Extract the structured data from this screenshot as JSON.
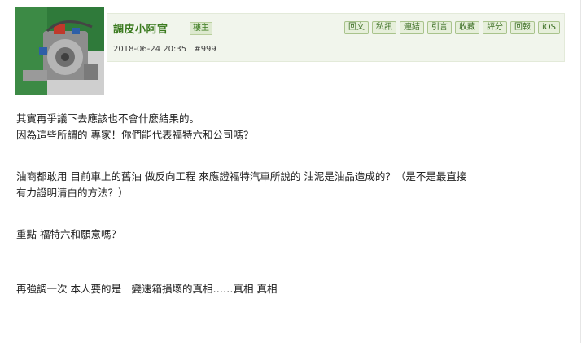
{
  "post": {
    "author": "調皮小阿官",
    "role": "樓主",
    "timestamp": "2018-06-24 20:35",
    "post_number": "#999",
    "actions": [
      "回文",
      "私訊",
      "連結",
      "引言",
      "收藏",
      "評分",
      "回報",
      "iOS"
    ],
    "body": [
      "其實再爭議下去應該也不會什麼結果的。",
      "因為這些所謂的 專家！你們能代表福特六和公司嗎？",
      "油商都敢用 目前車上的舊油 做反向工程 來應證福特汽車所說的 油泥是油品造成的？（是不是最直接",
      "有力證明清白的方法？）",
      "重點 福特六和願意嗎？",
      "再強調一次 本人要的是　變速箱損壞的真相……真相 真相"
    ]
  },
  "colors": {
    "header_bg": "#f1f5ec",
    "author_color": "#3a7a1e",
    "button_bg": "#e6efda",
    "button_border": "#a9c38c"
  }
}
